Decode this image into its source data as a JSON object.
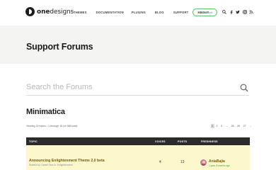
{
  "brand": {
    "name_bold": "one",
    "name_rest": "designs"
  },
  "nav": {
    "items": [
      {
        "label": "THEMES"
      },
      {
        "label": "DOCUMENTATION"
      },
      {
        "label": "PLUGINS"
      },
      {
        "label": "BLOG"
      },
      {
        "label": "SUPPORT"
      },
      {
        "label": "ABOUT"
      }
    ],
    "account_label": "My Account",
    "icons": [
      "search-icon",
      "facebook-icon",
      "twitter-icon",
      "instagram-icon",
      "rss-icon"
    ]
  },
  "page": {
    "title": "Support Forums"
  },
  "search": {
    "placeholder": "Search the Forums",
    "value": ""
  },
  "forum": {
    "title": "Minimatica",
    "viewing_text": "Viewing 15 topics - 1 through 15 (of 388 total)",
    "pagination": [
      "1",
      "2",
      "3",
      "…",
      "25",
      "26",
      "27",
      "→"
    ],
    "current_page": "1"
  },
  "table": {
    "headers": {
      "topic": "TOPIC",
      "voices": "VOICES",
      "posts": "POSTS",
      "freshness": "FRESHNESS"
    },
    "rows": [
      {
        "topic": "Announcing Enlightenment Theme 2.0 beta",
        "meta": "Started by: Daniel Tara in: Enlightenment",
        "voices": "4",
        "posts": "13",
        "fresh_user": "AniaBajia",
        "fresh_time": "1 year, 8 months ago"
      }
    ]
  },
  "colors": {
    "accent_green": "#3e9a3e",
    "title_band": "#f4f4f2",
    "table_header": "#2b2b2b",
    "sticky_row": "#fdf8cc",
    "link_brown": "#7a5a0e"
  }
}
